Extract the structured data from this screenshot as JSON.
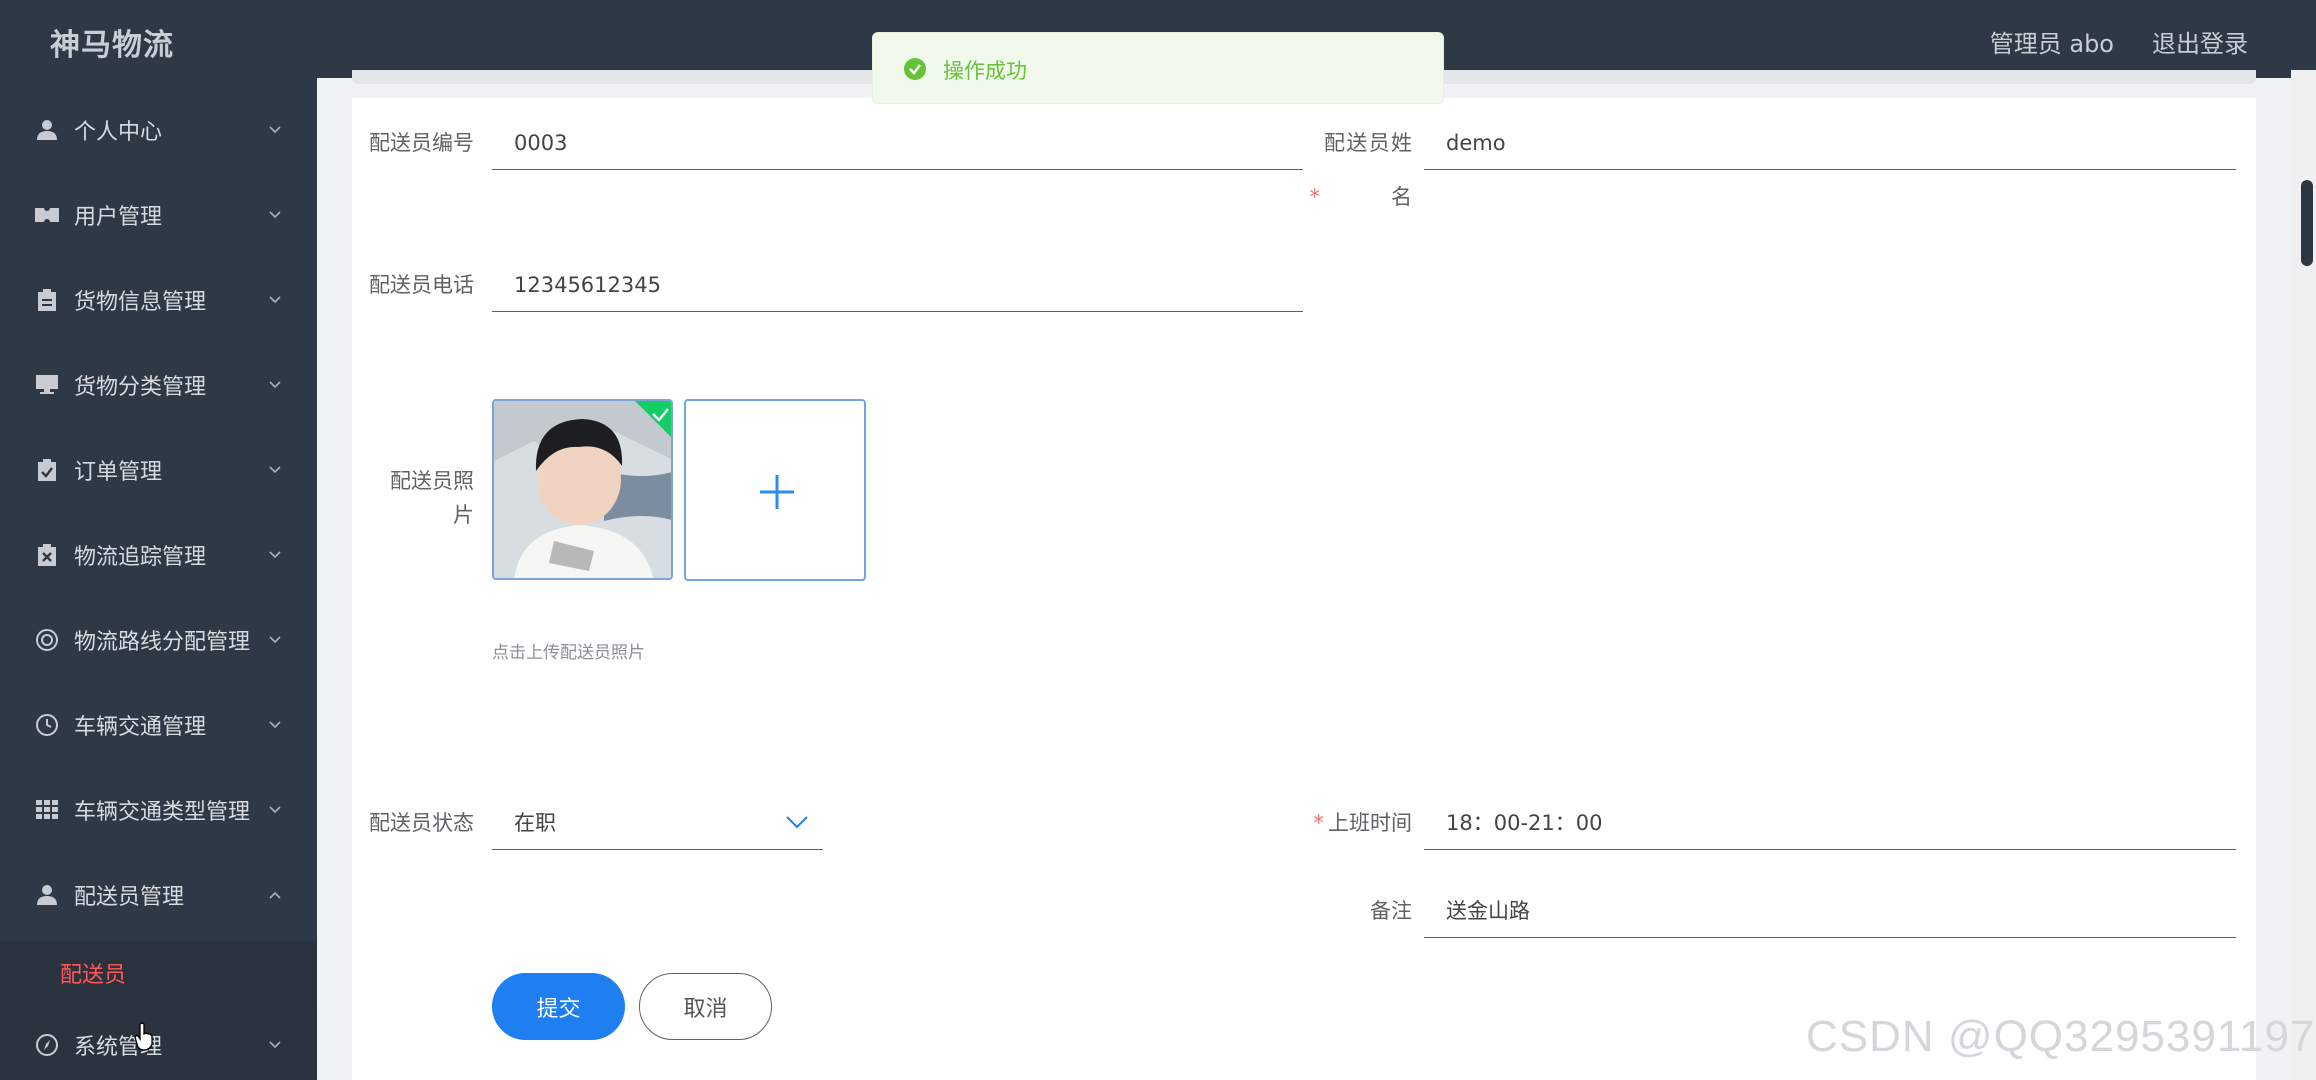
{
  "header": {
    "logo": "神马物流",
    "user": "管理员 abo",
    "logout": "退出登录"
  },
  "sidebar": {
    "items": [
      {
        "label": "个人中心",
        "icon": "user-icon"
      },
      {
        "label": "用户管理",
        "icon": "ticket-icon"
      },
      {
        "label": "货物信息管理",
        "icon": "clipboard-icon"
      },
      {
        "label": "货物分类管理",
        "icon": "monitor-icon"
      },
      {
        "label": "订单管理",
        "icon": "checklist-icon"
      },
      {
        "label": "物流追踪管理",
        "icon": "clipboard-x-icon"
      },
      {
        "label": "物流路线分配管理",
        "icon": "lifebuoy-icon"
      },
      {
        "label": "车辆交通管理",
        "icon": "clock-icon"
      },
      {
        "label": "车辆交通类型管理",
        "icon": "grid-icon"
      },
      {
        "label": "配送员管理",
        "icon": "user-icon"
      },
      {
        "label": "系统管理",
        "icon": "compass-icon"
      }
    ],
    "sub_item": "配送员"
  },
  "form": {
    "courier_id": {
      "label": "配送员编号",
      "value": "0003"
    },
    "courier_name": {
      "label": "配送员姓名",
      "value": "demo"
    },
    "courier_phone": {
      "label": "配送员电话",
      "value": "12345612345"
    },
    "courier_photo": {
      "label": "配送员照片",
      "hint": "点击上传配送员照片"
    },
    "courier_status": {
      "label": "配送员状态",
      "value": "在职"
    },
    "work_time": {
      "label": "上班时间",
      "value": "18：00-21：00"
    },
    "remark": {
      "label": "备注",
      "value": "送金山路"
    },
    "submit": "提交",
    "cancel": "取消"
  },
  "toast": {
    "text": "操作成功"
  },
  "watermark": "CSDN @QQ3295391197",
  "colors": {
    "primary": "#1f7ef0",
    "success": "#67c23a",
    "sidebar": "#2f3945",
    "active_menu": "#ff5a5a"
  }
}
